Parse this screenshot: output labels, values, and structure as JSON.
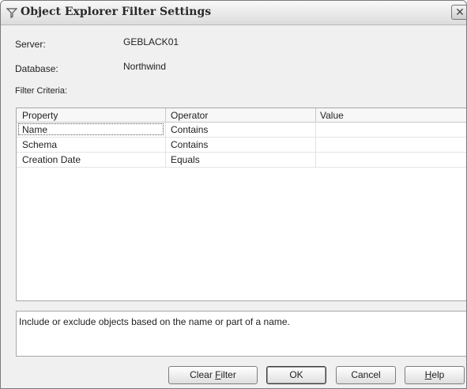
{
  "window": {
    "title": "Object Explorer Filter Settings",
    "close_icon": "close-icon"
  },
  "server": {
    "label": "Server:",
    "value": "GEBLACK01"
  },
  "database": {
    "label": "Database:",
    "value": "Northwind"
  },
  "filter_criteria_label": "Filter Criteria:",
  "grid": {
    "columns": [
      "Property",
      "Operator",
      "Value"
    ],
    "rows": [
      {
        "property": "Name",
        "operator": "Contains",
        "value": ""
      },
      {
        "property": "Schema",
        "operator": "Contains",
        "value": ""
      },
      {
        "property": "Creation Date",
        "operator": "Equals",
        "value": ""
      }
    ]
  },
  "description": "Include or exclude objects based on the name or part of a name.",
  "buttons": {
    "clear_filter": {
      "pre": "Clear ",
      "access": "F",
      "post": "ilter"
    },
    "ok": "OK",
    "cancel": "Cancel",
    "help": {
      "access": "H",
      "post": "elp"
    }
  }
}
